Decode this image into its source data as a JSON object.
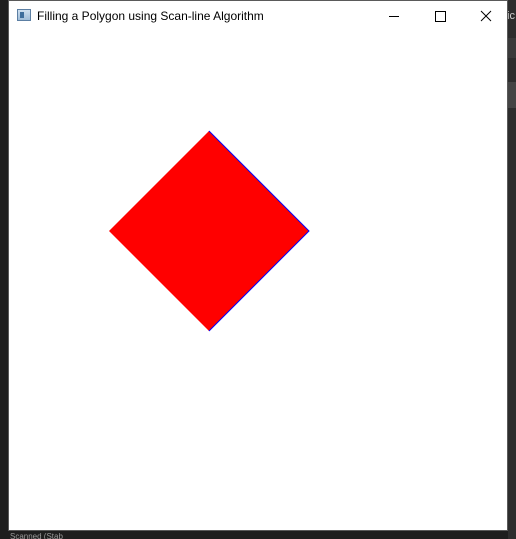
{
  "window": {
    "title": "Filling a Polygon using Scan-line Algorithm",
    "controls": {
      "minimize_icon": "minimize-icon",
      "maximize_icon": "maximize-icon",
      "close_icon": "close-icon"
    }
  },
  "background": {
    "partial_glyph": "ic",
    "taskbar_label": "Scanned (Stab"
  },
  "canvas": {
    "polygon": {
      "shape": "diamond",
      "fill_color": "#ff0000",
      "edge_color": "#0000ff"
    }
  },
  "colors": {
    "titlebar": "#ffffff",
    "client_bg": "#ffffff",
    "desktop": "#1e1e1e"
  }
}
